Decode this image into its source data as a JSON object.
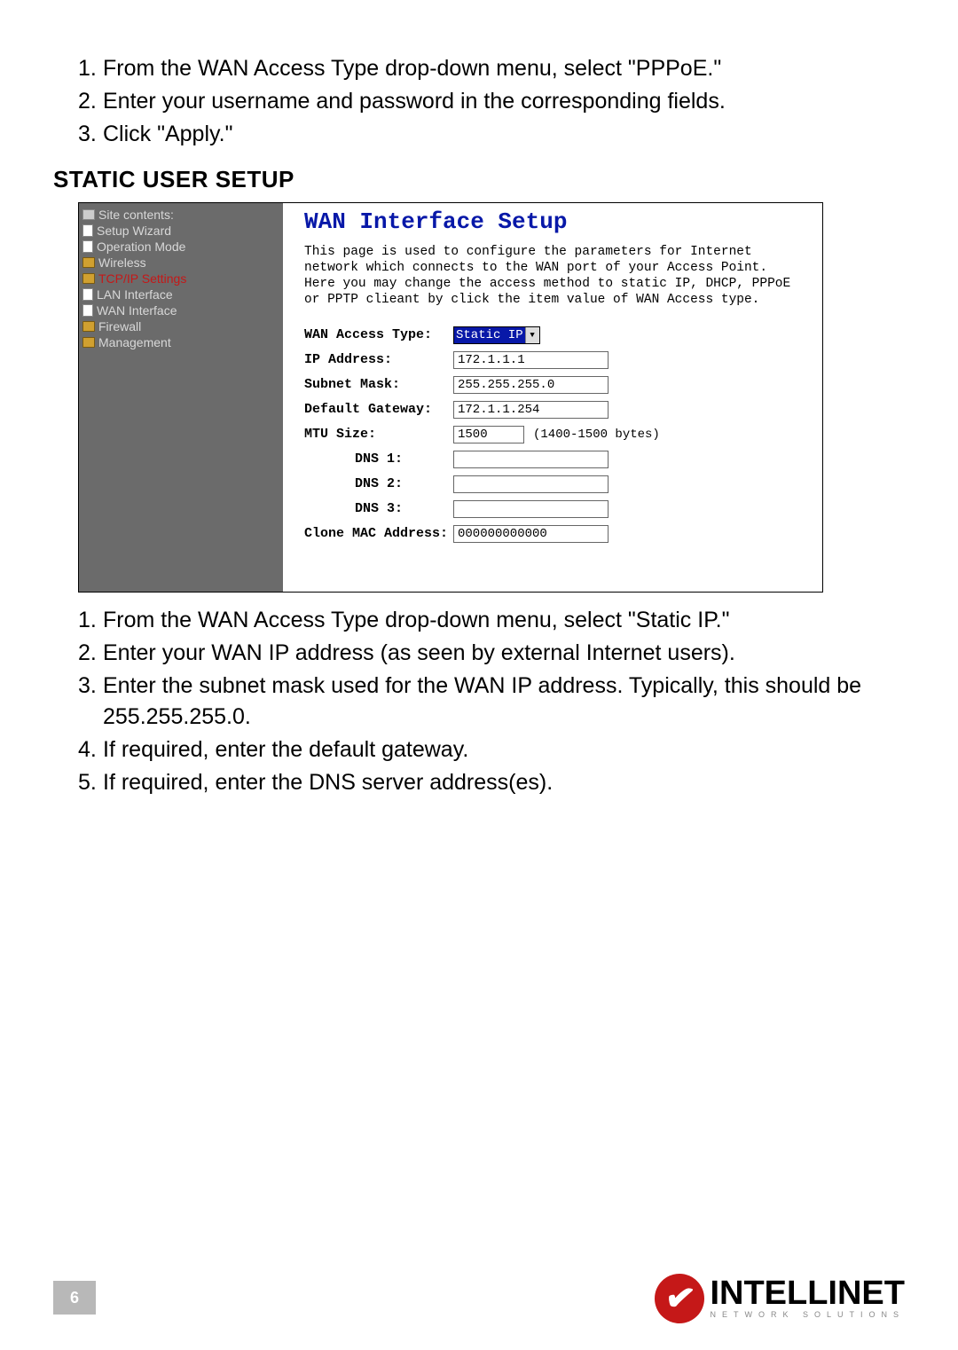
{
  "pppoe_steps": [
    {
      "num": "1.",
      "text": "From the WAN Access Type drop-down menu, select \"PPPoE.\""
    },
    {
      "num": "2.",
      "text": "Enter your username and password in the corresponding fields."
    },
    {
      "num": "3.",
      "text": "Click \"Apply.\""
    }
  ],
  "section_heading": "STATIC USER SETUP",
  "sidebar": {
    "root": "Site contents:",
    "items": [
      {
        "label": "Setup Wizard",
        "indent": 1,
        "icon": "page"
      },
      {
        "label": "Operation Mode",
        "indent": 1,
        "icon": "page"
      },
      {
        "label": "Wireless",
        "indent": 1,
        "icon": "folder"
      },
      {
        "label": "TCP/IP Settings",
        "indent": 1,
        "icon": "folder-open",
        "active": true
      },
      {
        "label": "LAN Interface",
        "indent": 2,
        "icon": "page"
      },
      {
        "label": "WAN Interface",
        "indent": 2,
        "icon": "page"
      },
      {
        "label": "Firewall",
        "indent": 1,
        "icon": "folder"
      },
      {
        "label": "Management",
        "indent": 1,
        "icon": "folder"
      }
    ]
  },
  "panel": {
    "title": "WAN Interface Setup",
    "desc": "This page is used to configure the parameters for Internet network which connects to the WAN port of your Access Point. Here you may change the access method to static IP, DHCP, PPPoE or PPTP clieant by click the item value of WAN Access type.",
    "fields": {
      "wan_access_type": {
        "label": "WAN Access Type:",
        "value": "Static IP"
      },
      "ip_address": {
        "label": "IP Address:",
        "value": "172.1.1.1"
      },
      "subnet_mask": {
        "label": "Subnet Mask:",
        "value": "255.255.255.0"
      },
      "default_gateway": {
        "label": "Default Gateway:",
        "value": "172.1.1.254"
      },
      "mtu_size": {
        "label": "MTU Size:",
        "value": "1500",
        "note": "(1400-1500 bytes)"
      },
      "dns1": {
        "label": "DNS 1:",
        "value": ""
      },
      "dns2": {
        "label": "DNS 2:",
        "value": ""
      },
      "dns3": {
        "label": "DNS 3:",
        "value": ""
      },
      "clone_mac": {
        "label": "Clone MAC Address:",
        "value": "000000000000"
      }
    }
  },
  "static_steps": [
    {
      "num": "1.",
      "text": "From the WAN Access Type drop-down menu, select \"Static IP.\""
    },
    {
      "num": "2.",
      "text": "Enter your WAN IP address (as seen by external Internet users)."
    },
    {
      "num": "3.",
      "text": "Enter the subnet mask used for the WAN IP address. Typically, this should be 255.255.255.0."
    },
    {
      "num": "4.",
      "text": "If required, enter the default gateway."
    },
    {
      "num": "5.",
      "text": "If required, enter the DNS server address(es)."
    }
  ],
  "page_number": "6",
  "logo": {
    "text": "INTELLINET",
    "sub": "NETWORK SOLUTIONS"
  }
}
